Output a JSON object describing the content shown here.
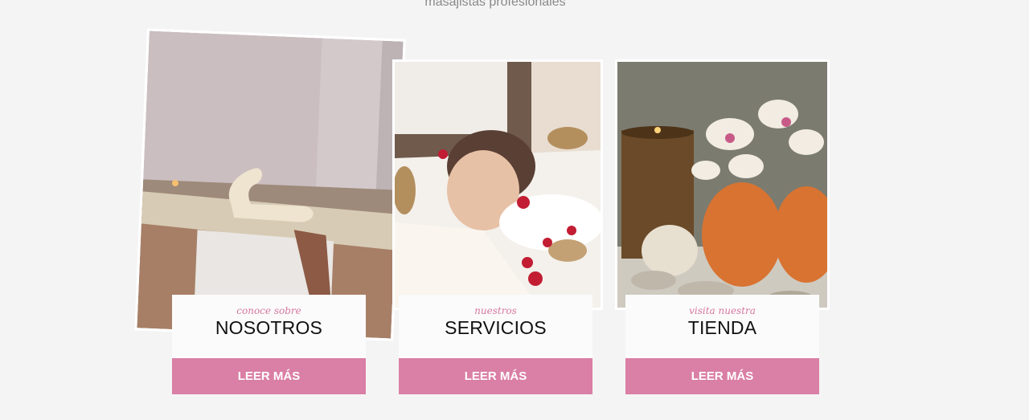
{
  "header": {
    "subtitle": "masajistas profesionales"
  },
  "cards": [
    {
      "kicker": "conoce sobre",
      "title": "NOSOTROS",
      "button": "LEER MÁS",
      "image": "towel-swan-massage-bed-photo"
    },
    {
      "kicker": "nuestros",
      "title": "SERVICIOS",
      "button": "LEER MÁS",
      "image": "woman-relaxing-spa-photo"
    },
    {
      "kicker": "visita nuestra",
      "title": "TIENDA",
      "button": "LEER MÁS",
      "image": "spa-towels-orchids-candle-photo"
    }
  ],
  "colors": {
    "accent": "#da7fa5",
    "kicker": "#d6789f",
    "background": "#f4f4f4"
  }
}
